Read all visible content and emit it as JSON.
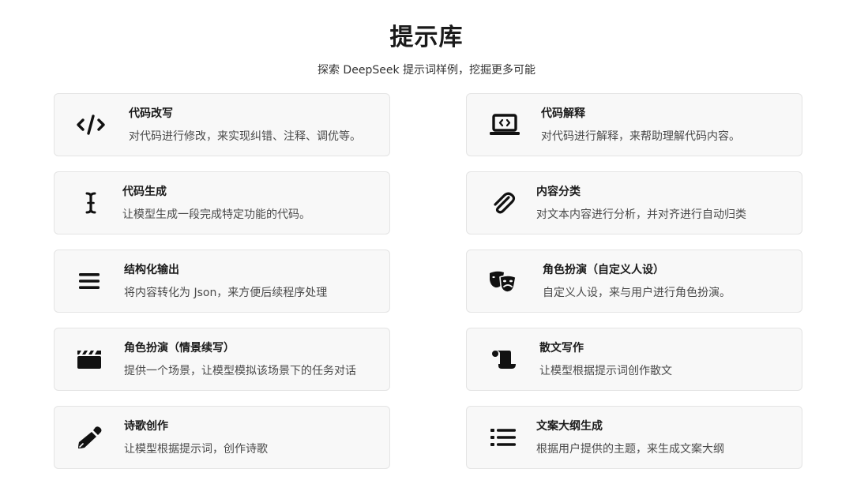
{
  "header": {
    "title": "提示库",
    "subtitle": "探索 DeepSeek 提示词样例，挖掘更多可能"
  },
  "cards": [
    {
      "title": "代码改写",
      "desc": "对代码进行修改，来实现纠错、注释、调优等。",
      "icon": "code-icon"
    },
    {
      "title": "代码解释",
      "desc": "对代码进行解释，来帮助理解代码内容。",
      "icon": "laptop-code-icon"
    },
    {
      "title": "代码生成",
      "desc": "让模型生成一段完成特定功能的代码。",
      "icon": "text-cursor-icon"
    },
    {
      "title": "内容分类",
      "desc": "对文本内容进行分析，并对齐进行自动归类",
      "icon": "paperclip-icon"
    },
    {
      "title": "结构化输出",
      "desc": "将内容转化为 Json，来方便后续程序处理",
      "icon": "menu-bars-icon"
    },
    {
      "title": "角色扮演（自定义人设）",
      "desc": "自定义人设，来与用户进行角色扮演。",
      "icon": "theater-masks-icon"
    },
    {
      "title": "角色扮演（情景续写）",
      "desc": "提供一个场景，让模型模拟该场景下的任务对话",
      "icon": "clapperboard-icon"
    },
    {
      "title": "散文写作",
      "desc": "让模型根据提示词创作散文",
      "icon": "scroll-icon"
    },
    {
      "title": "诗歌创作",
      "desc": "让模型根据提示词，创作诗歌",
      "icon": "pen-icon"
    },
    {
      "title": "文案大纲生成",
      "desc": "根据用户提供的主题，来生成文案大纲",
      "icon": "list-icon"
    }
  ]
}
